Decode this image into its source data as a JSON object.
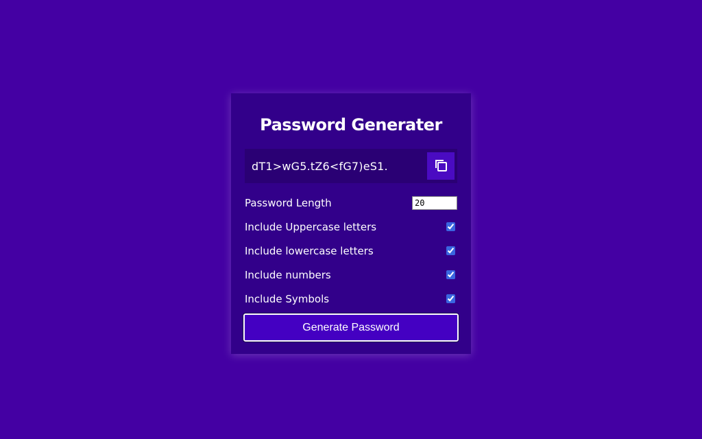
{
  "app": {
    "title": "Password Generater"
  },
  "result": {
    "password": "dT1>wG5.tZ6<fG7)eS1.",
    "copy_icon": "clipboard-copy-icon"
  },
  "settings": [
    {
      "label": "Password Length",
      "type": "number",
      "value": "20"
    },
    {
      "label": "Include Uppercase letters",
      "type": "checkbox",
      "checked": true
    },
    {
      "label": "Include lowercase letters",
      "type": "checkbox",
      "checked": true
    },
    {
      "label": "Include numbers",
      "type": "checkbox",
      "checked": true
    },
    {
      "label": "Include Symbols",
      "type": "checkbox",
      "checked": true
    }
  ],
  "actions": {
    "generate_label": "Generate Password"
  },
  "colors": {
    "background": "#4400a3",
    "card": "#32008a",
    "result_box": "#2a0074",
    "accent_button": "#4400c2",
    "text": "#ffffff"
  }
}
